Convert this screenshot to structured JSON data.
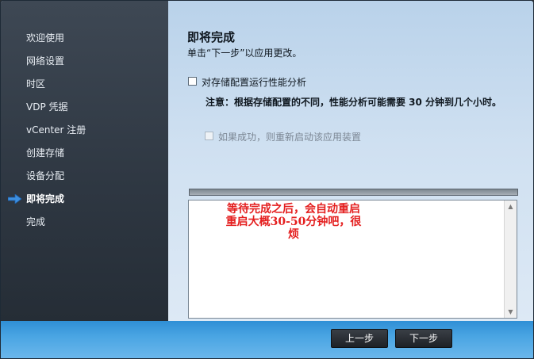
{
  "sidebar": {
    "items": [
      {
        "label": "欢迎使用"
      },
      {
        "label": "网络设置"
      },
      {
        "label": "时区"
      },
      {
        "label": "VDP 凭据"
      },
      {
        "label": "vCenter 注册"
      },
      {
        "label": "创建存储"
      },
      {
        "label": "设备分配"
      },
      {
        "label": "即将完成"
      },
      {
        "label": "完成"
      }
    ],
    "active_index": 7
  },
  "main": {
    "title": "即将完成",
    "subtitle": "单击“下一步”以应用更改。",
    "checkbox_perf": {
      "label": "对存储配置运行性能分析",
      "checked": false
    },
    "note": "注意：根据存储配置的不同，性能分析可能需要 30 分钟到几个小时。",
    "checkbox_restart": {
      "label": "如果成功，则重新启动该应用装置",
      "checked": false,
      "enabled": false
    },
    "progress_percent": 0,
    "annotation_lines": [
      "等待完成之后，会自动重启",
      "重启大概30-50分钟吧，很",
      "烦"
    ]
  },
  "buttons": {
    "back": "上一步",
    "next": "下一步"
  },
  "colors": {
    "sidebar_bg": "#2f3843",
    "footer_bg": "#4aa5e3",
    "annotation_red": "#e41f1f",
    "active_arrow": "#3d8fe0"
  },
  "icons": {
    "active_marker": "arrow-right-icon",
    "scroll_up": "triangle-up-icon",
    "scroll_down": "triangle-down-icon"
  }
}
